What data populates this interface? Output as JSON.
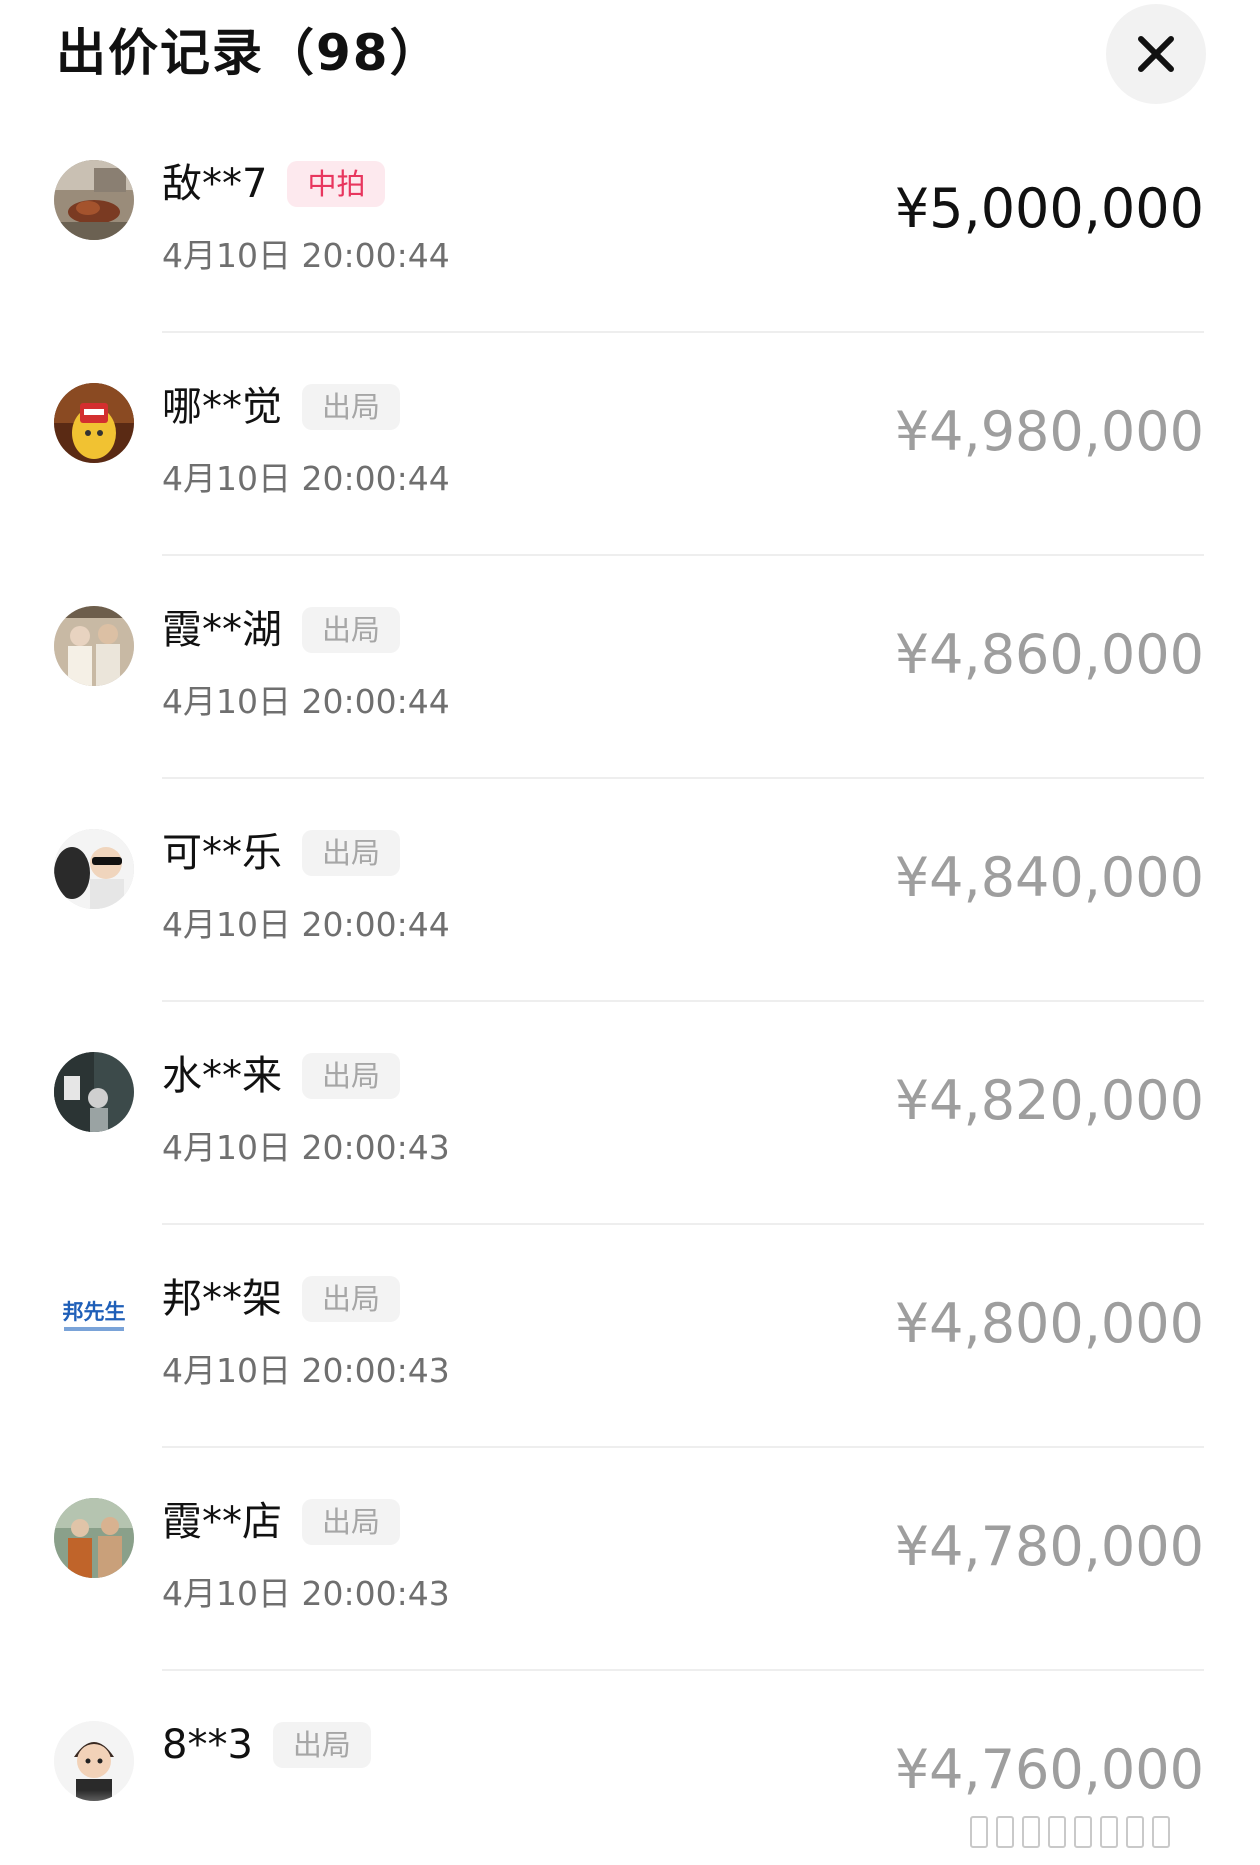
{
  "header": {
    "title": "出价记录（98）",
    "close_icon": "close-icon"
  },
  "colors": {
    "win_badge_bg": "#fde9ee",
    "win_badge_text": "#e8365e",
    "out_badge_bg": "#f3f3f3",
    "out_badge_text": "#a6a6a6",
    "price_win": "#111111",
    "price_out": "#9e9e9e"
  },
  "bids": [
    {
      "name": "敌**7",
      "status": "中拍",
      "status_type": "win",
      "time": "4月10日 20:00:44",
      "price": "¥5,000,000"
    },
    {
      "name": "哪**觉",
      "status": "出局",
      "status_type": "out",
      "time": "4月10日 20:00:44",
      "price": "¥4,980,000"
    },
    {
      "name": "霞**湖",
      "status": "出局",
      "status_type": "out",
      "time": "4月10日 20:00:44",
      "price": "¥4,860,000"
    },
    {
      "name": "可**乐",
      "status": "出局",
      "status_type": "out",
      "time": "4月10日 20:00:44",
      "price": "¥4,840,000"
    },
    {
      "name": "水**来",
      "status": "出局",
      "status_type": "out",
      "time": "4月10日 20:00:43",
      "price": "¥4,820,000"
    },
    {
      "name": "邦**架",
      "status": "出局",
      "status_type": "out",
      "time": "4月10日 20:00:43",
      "price": "¥4,800,000",
      "avatar_text": "邦先生"
    },
    {
      "name": "霞**店",
      "status": "出局",
      "status_type": "out",
      "time": "4月10日 20:00:43",
      "price": "¥4,780,000"
    },
    {
      "name": "8**3",
      "status": "出局",
      "status_type": "out",
      "time": "",
      "price": "¥4,760,000"
    }
  ]
}
